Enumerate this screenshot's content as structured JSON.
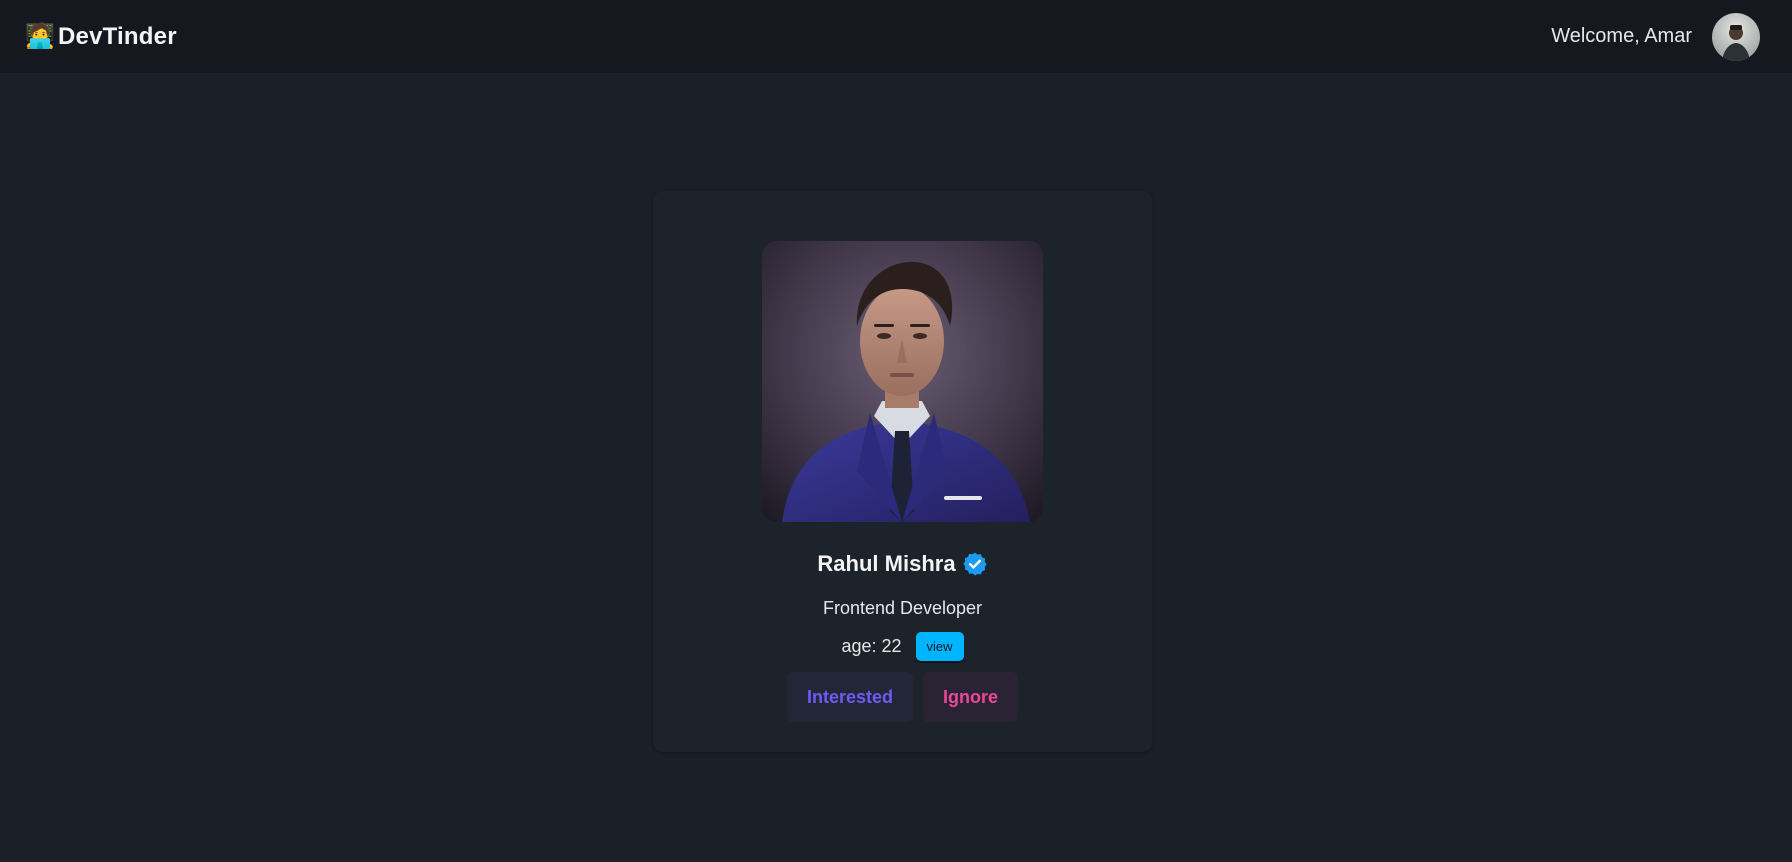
{
  "navbar": {
    "brand_emoji": "🧑‍💻",
    "brand_name": "DevTinder",
    "welcome_text": "Welcome, Amar",
    "avatar_icon": "user-avatar"
  },
  "card": {
    "photo_icon": "profile-photo",
    "name": "Rahul Mishra",
    "verified_icon": "verified-badge-icon",
    "role": "Frontend Developer",
    "age_text": "age: 22",
    "view_label": "view",
    "interested_label": "Interested",
    "ignore_label": "Ignore"
  },
  "colors": {
    "background": "#1b1f27",
    "navbar": "#15181e",
    "card": "#1d232a",
    "view_button": "#00b5ff",
    "interested_text": "#6b5cf6",
    "ignore_text": "#ec4899",
    "verified": "#1d9bf0"
  }
}
